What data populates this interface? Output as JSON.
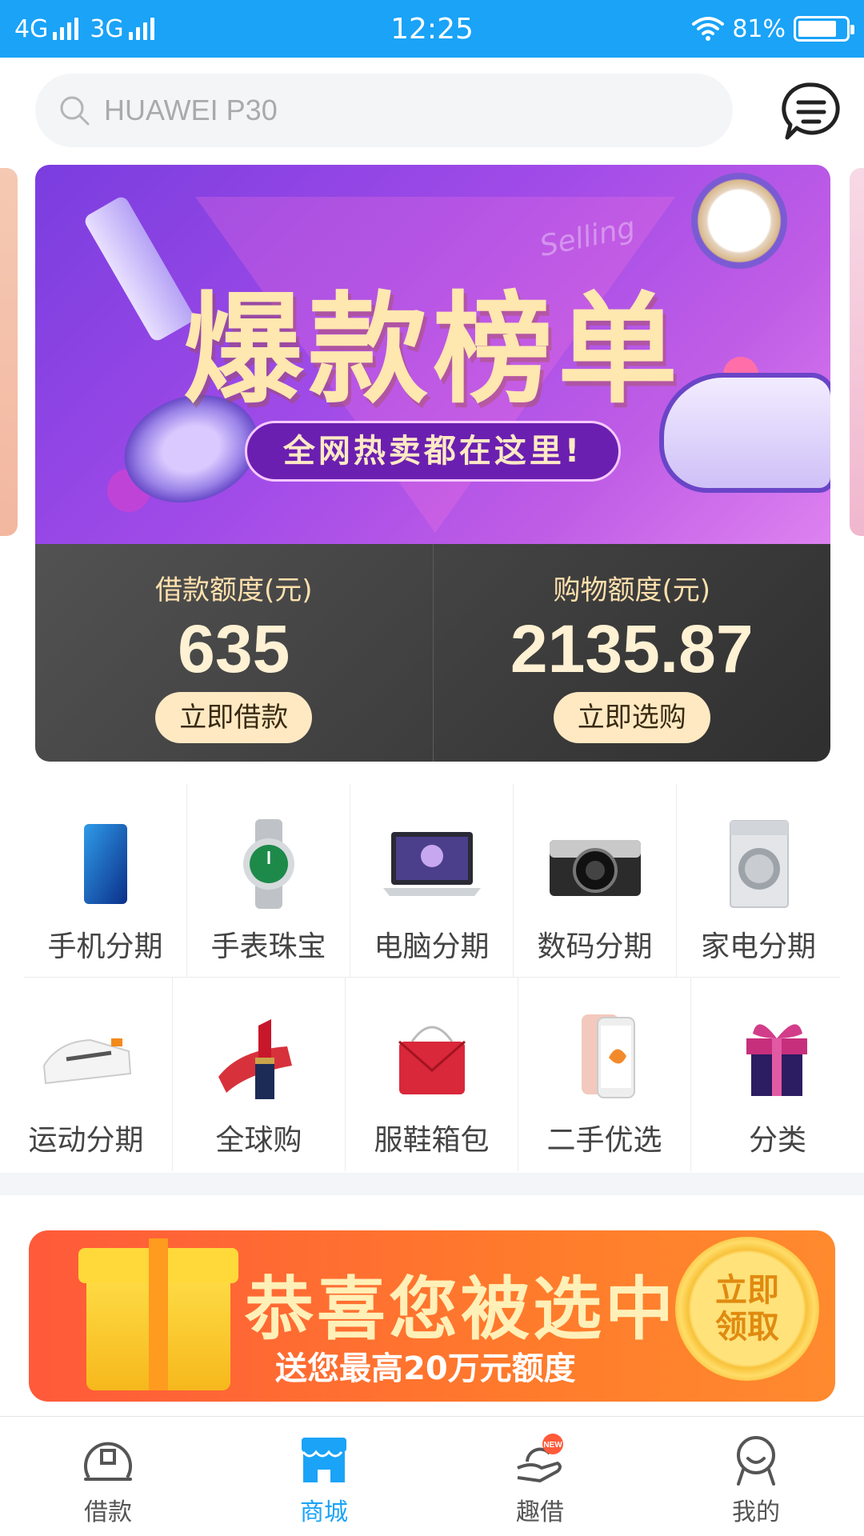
{
  "status_bar": {
    "net1": "4G",
    "net2": "3G",
    "time": "12:25",
    "battery": "81%",
    "battery_level": 0.81
  },
  "search": {
    "placeholder": "HUAWEI P30"
  },
  "banner": {
    "title": "爆款榜单",
    "subtitle": "全网热卖都在这里!",
    "decor_text": "Selling"
  },
  "credit": {
    "loan_label": "借款额度(元)",
    "loan_value": "635",
    "loan_button": "立即借款",
    "shop_label": "购物额度(元)",
    "shop_value": "2135.87",
    "shop_button": "立即选购"
  },
  "categories": [
    {
      "label": "手机分期",
      "icon": "phone-icon"
    },
    {
      "label": "手表珠宝",
      "icon": "watch-icon"
    },
    {
      "label": "电脑分期",
      "icon": "laptop-icon"
    },
    {
      "label": "数码分期",
      "icon": "camera-icon"
    },
    {
      "label": "家电分期",
      "icon": "washing-machine-icon"
    },
    {
      "label": "运动分期",
      "icon": "sneaker-icon"
    },
    {
      "label": "全球购",
      "icon": "lipstick-icon"
    },
    {
      "label": "服鞋箱包",
      "icon": "handbag-icon"
    },
    {
      "label": "二手优选",
      "icon": "iphone-icon"
    },
    {
      "label": "分类",
      "icon": "gift-icon"
    }
  ],
  "promo": {
    "title": "恭喜您被选中!",
    "subtitle": "送您最高20万元额度",
    "coin_text": "立即领取"
  },
  "tabs": [
    {
      "label": "借款",
      "icon": "loan-icon"
    },
    {
      "label": "商城",
      "icon": "store-icon"
    },
    {
      "label": "趣借",
      "icon": "hand-coin-icon",
      "badge": "NEW"
    },
    {
      "label": "我的",
      "icon": "profile-icon"
    }
  ],
  "colors": {
    "accent": "#1aa3f7",
    "credit_text": "#ffe2ae",
    "promo": "#ff6a34"
  }
}
